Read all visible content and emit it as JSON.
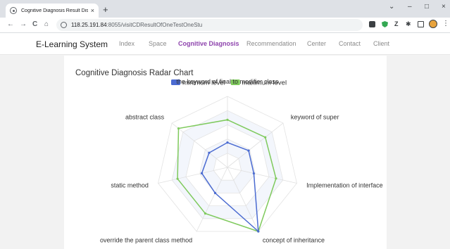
{
  "browser": {
    "tab_title": "Cognitive Diagnosis Result Display",
    "tab_close": "×",
    "new_tab": "+",
    "window_controls": {
      "minimize": "–",
      "maximize": "□",
      "close": "×"
    },
    "nav": {
      "back": "←",
      "forward": "→",
      "reload": "C",
      "home": "⌂"
    },
    "url_host": "118.25.191.84",
    "url_path": ":8055/visitCDResultOfOneTestOneStu",
    "menu": "⋮"
  },
  "site": {
    "brand": "E-Learning System",
    "nav": [
      {
        "label": "Index",
        "active": false
      },
      {
        "label": "Space",
        "active": false
      },
      {
        "label": "Cognitive Diagnosis",
        "active": true
      },
      {
        "label": "Recommendation",
        "active": false
      },
      {
        "label": "Center",
        "active": false
      },
      {
        "label": "Contact",
        "active": false
      },
      {
        "label": "Client",
        "active": false
      }
    ]
  },
  "chart_data": {
    "type": "radar",
    "title": "Cognitive Diagnosis Radar Chart",
    "indicators": [
      "the keyword of final to modifier class",
      "keyword of super",
      "Implementation of interface",
      "concept of inheritance",
      "override the parent class method",
      "static method",
      "abstract class"
    ],
    "max": 1,
    "split_number": 5,
    "series": [
      {
        "name": "minimum level",
        "color": "#4b6bd1",
        "values": [
          0.35,
          0.38,
          0.38,
          1.0,
          0.4,
          0.37,
          0.33
        ]
      },
      {
        "name": "maximum level",
        "color": "#7fca5d",
        "values": [
          0.67,
          0.68,
          0.7,
          1.0,
          0.72,
          0.72,
          0.88
        ]
      }
    ],
    "legend_position": "top-center"
  }
}
